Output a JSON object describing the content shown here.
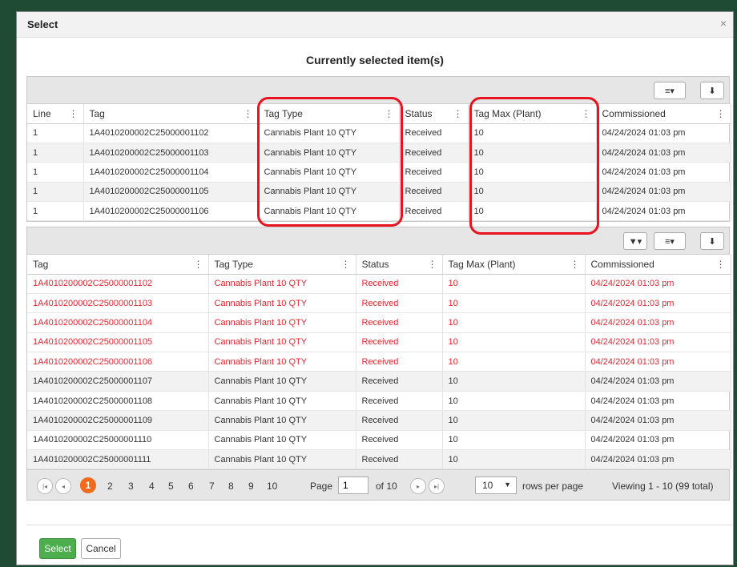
{
  "dialog": {
    "title": "Select",
    "close": "×",
    "section_title": "Currently selected item(s)"
  },
  "icons": {
    "menu": "≡▾",
    "download": "⬇",
    "filter": "▼▾",
    "col_menu": "⋮"
  },
  "top_grid": {
    "columns": [
      "Line",
      "Tag",
      "Tag Type",
      "Status",
      "Tag Max (Plant)",
      "Commissioned"
    ],
    "rows": [
      [
        "1",
        "1A4010200002C25000001102",
        "Cannabis Plant 10 QTY",
        "Received",
        "10",
        "04/24/2024 01:03 pm"
      ],
      [
        "1",
        "1A4010200002C25000001103",
        "Cannabis Plant 10 QTY",
        "Received",
        "10",
        "04/24/2024 01:03 pm"
      ],
      [
        "1",
        "1A4010200002C25000001104",
        "Cannabis Plant 10 QTY",
        "Received",
        "10",
        "04/24/2024 01:03 pm"
      ],
      [
        "1",
        "1A4010200002C25000001105",
        "Cannabis Plant 10 QTY",
        "Received",
        "10",
        "04/24/2024 01:03 pm"
      ],
      [
        "1",
        "1A4010200002C25000001106",
        "Cannabis Plant 10 QTY",
        "Received",
        "10",
        "04/24/2024 01:03 pm"
      ]
    ]
  },
  "bottom_grid": {
    "columns": [
      "Tag",
      "Tag Type",
      "Status",
      "Tag Max (Plant)",
      "Commissioned"
    ],
    "rows": [
      [
        "1A4010200002C25000001102",
        "Cannabis Plant 10 QTY",
        "Received",
        "10",
        "04/24/2024 01:03 pm"
      ],
      [
        "1A4010200002C25000001103",
        "Cannabis Plant 10 QTY",
        "Received",
        "10",
        "04/24/2024 01:03 pm"
      ],
      [
        "1A4010200002C25000001104",
        "Cannabis Plant 10 QTY",
        "Received",
        "10",
        "04/24/2024 01:03 pm"
      ],
      [
        "1A4010200002C25000001105",
        "Cannabis Plant 10 QTY",
        "Received",
        "10",
        "04/24/2024 01:03 pm"
      ],
      [
        "1A4010200002C25000001106",
        "Cannabis Plant 10 QTY",
        "Received",
        "10",
        "04/24/2024 01:03 pm"
      ],
      [
        "1A4010200002C25000001107",
        "Cannabis Plant 10 QTY",
        "Received",
        "10",
        "04/24/2024 01:03 pm"
      ],
      [
        "1A4010200002C25000001108",
        "Cannabis Plant 10 QTY",
        "Received",
        "10",
        "04/24/2024 01:03 pm"
      ],
      [
        "1A4010200002C25000001109",
        "Cannabis Plant 10 QTY",
        "Received",
        "10",
        "04/24/2024 01:03 pm"
      ],
      [
        "1A4010200002C25000001110",
        "Cannabis Plant 10 QTY",
        "Received",
        "10",
        "04/24/2024 01:03 pm"
      ],
      [
        "1A4010200002C25000001111",
        "Cannabis Plant 10 QTY",
        "Received",
        "10",
        "04/24/2024 01:03 pm"
      ]
    ],
    "selected_count": 5
  },
  "pager": {
    "first": "|◂",
    "prev": "◂",
    "next": "▸",
    "last": "▸|",
    "current_page": "1",
    "pages": [
      "2",
      "3",
      "4",
      "5",
      "6",
      "7",
      "8",
      "9",
      "10"
    ],
    "page_label": "Page",
    "page_input": "1",
    "of_label": "of 10",
    "rows_value": "10",
    "rows_caret": "▼",
    "rows_label": "rows per page",
    "viewing": "Viewing 1 - 10 (99 total)"
  },
  "footer": {
    "select_label": "Select",
    "cancel_label": "Cancel"
  },
  "colors": {
    "selected_text": "#e8242f",
    "highlight": "#e8131f",
    "active_page": "#f26a1b",
    "select_button": "#4cae4c"
  }
}
